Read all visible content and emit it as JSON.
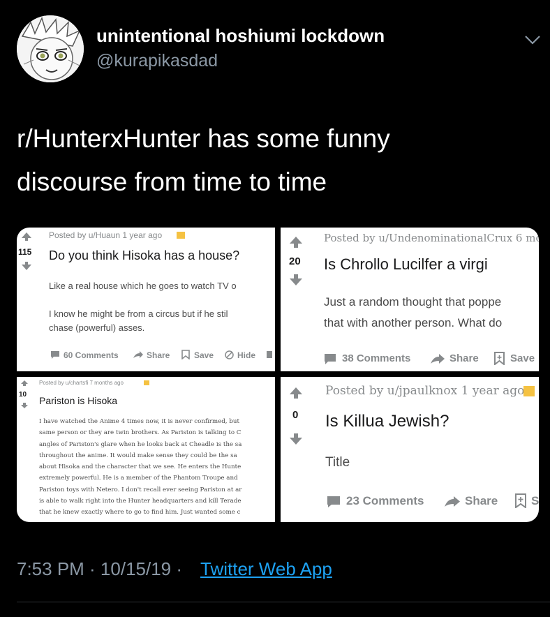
{
  "tweet": {
    "display_name": "unintentional hoshiumi lockdown",
    "handle": "@kurapikasdad",
    "line1": "r/HunterxHunter has some funny",
    "line2": "discourse from time to time",
    "time": "7:53 PM · 10/15/19 · ",
    "source": "Twitter Web App"
  },
  "posts": [
    {
      "meta": "Posted by u/Huaun 1 year ago",
      "votes": "115",
      "title": "Do you think Hisoka has a house?",
      "body": [
        "Like a real house which he goes to watch TV o",
        "",
        "I know he might be from a circus but if he stil",
        "chase (powerful) asses."
      ],
      "comments": "60 Comments",
      "share": "Share",
      "save": "Save",
      "hide": "Hide"
    },
    {
      "meta": "Posted by u/UndenominationalCrux 6 mo",
      "votes": "20",
      "title": "Is Chrollo Lucilfer a virgi",
      "body": [
        "Just a random thought that poppe",
        "that with another person. What do"
      ],
      "comments": "38 Comments",
      "share": "Share",
      "save": "Save"
    },
    {
      "meta": "Posted by u/chartsfi 7 months ago",
      "votes": "10",
      "title": "Pariston is Hisoka",
      "body": [
        "I have watched the Anime 4 times now, it is never confirmed, but",
        "same person or they are twin brothers. As Pariston is talking to C",
        "angles of Pariston's glare when he looks back at Cheadle is the sa",
        "throughout the anime. It would make sense they could be the sa",
        "about Hisoka and the character that we see. He enters the Hunte",
        "extremely powerful. He is a member of the Phantom Troupe and",
        "Pariston toys with Netero. I don't recall ever seeing Pariston at ar",
        "is able to walk right into the Hunter headquarters and kill Terade",
        "that he knew exactly where to go to find him. Just wanted some c"
      ]
    },
    {
      "meta": "Posted by u/jpaulknox 1 year ago",
      "votes": "0",
      "title": "Is Killua Jewish?",
      "body": [
        "Title"
      ],
      "comments": "23 Comments",
      "share": "Share",
      "save": "S"
    }
  ],
  "colors": {
    "background": "#000000",
    "secondary_text": "#8b98a5",
    "link": "#1da1f2",
    "badge": "#f5c242"
  },
  "icons": [
    "chevron-down-icon",
    "upvote-icon",
    "downvote-icon",
    "comment-icon",
    "share-icon",
    "save-icon",
    "hide-icon",
    "award-icon"
  ]
}
